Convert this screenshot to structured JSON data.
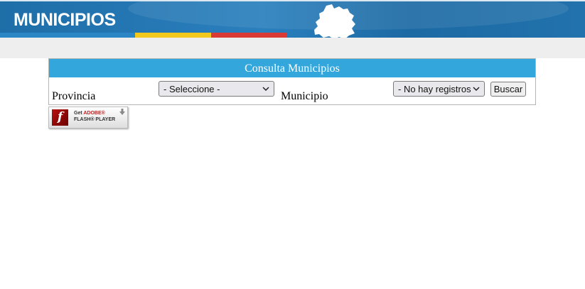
{
  "header": {
    "title": "MUNICIPIOS",
    "stripe_colors": [
      "#2b86c6",
      "#f2c81c",
      "#d93a33"
    ],
    "map_icon": "region-map-icon"
  },
  "panel": {
    "title": "Consulta Municipios",
    "provincia_label": "Provincia",
    "provincia_select": "- Seleccione -",
    "municipio_label": "Municipio",
    "municipio_select": "- No hay registros",
    "search_button": "Buscar"
  },
  "flash_badge": {
    "get": "Get",
    "adobe": "ADOBE®",
    "player": "FLASH® PLAYER",
    "logo_glyph": "f",
    "icon": "download-arrow-icon"
  }
}
